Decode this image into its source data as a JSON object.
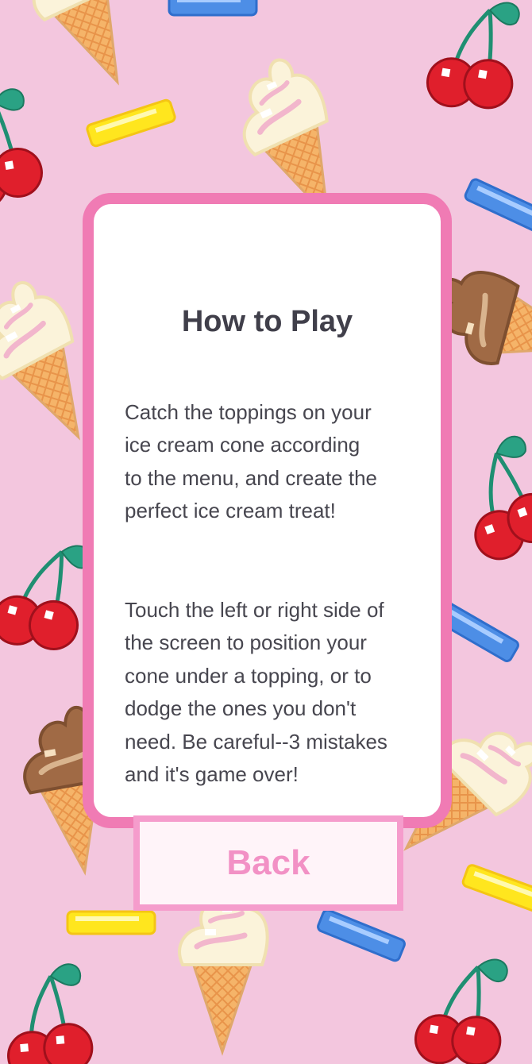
{
  "how_to_play": {
    "title": "How to Play",
    "paragraph_1": "Catch the toppings on your\nice cream cone according\nto the menu, and create the\nperfect ice cream treat!",
    "paragraph_2": "Touch the left or right side of\nthe screen to position your\ncone under a topping, or to\ndodge  the ones you don't\nneed. Be careful--3 mistakes\nand it's game over!"
  },
  "back_button": {
    "label": "Back"
  },
  "background": {
    "color": "#f3c6de",
    "decorations": [
      "ice-cream-cone-icon",
      "cherries-icon",
      "sprinkle-icon"
    ]
  },
  "colors": {
    "card_border": "#f07bb4",
    "button_border": "#f59ccc",
    "button_text": "#f291c5",
    "title_text": "#403f4a"
  }
}
